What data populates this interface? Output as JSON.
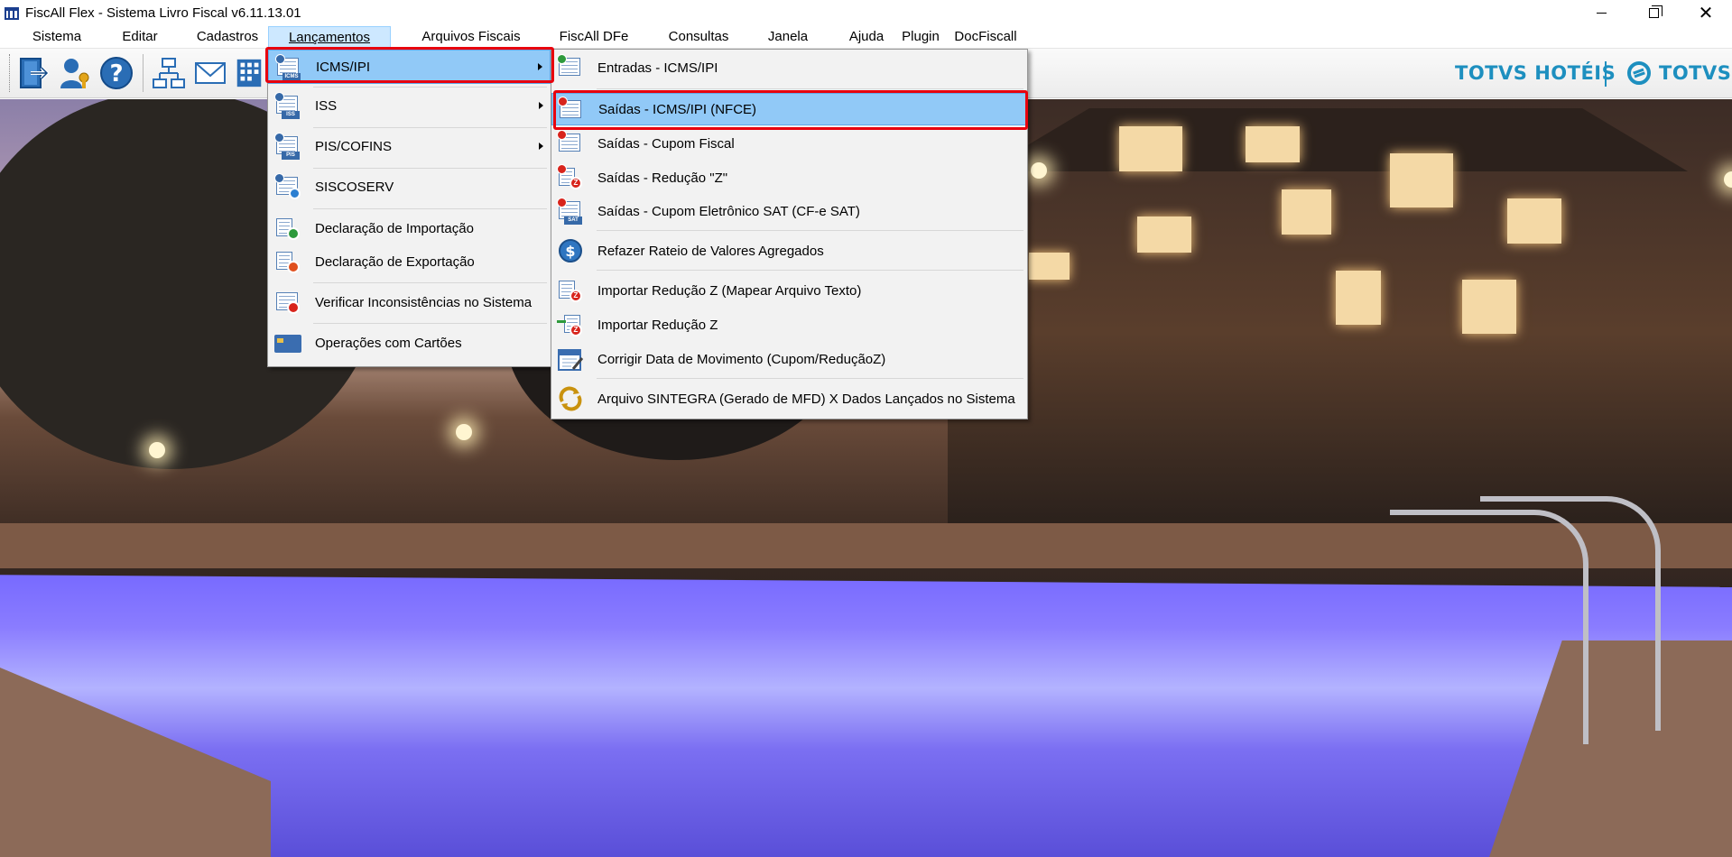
{
  "window": {
    "title": "FiscAll Flex - Sistema Livro Fiscal v6.11.13.01",
    "controls": {
      "minimize": "minimize-icon",
      "maximize": "restore-icon",
      "close": "close-icon"
    }
  },
  "menubar": {
    "items": [
      {
        "label": "Sistema"
      },
      {
        "label": "Editar"
      },
      {
        "label": "Cadastros"
      },
      {
        "label": "Lançamentos",
        "active": true
      },
      {
        "label": "Arquivos Fiscais"
      },
      {
        "label": "FiscAll DFe"
      },
      {
        "label": "Consultas"
      },
      {
        "label": "Janela"
      },
      {
        "label": "Ajuda"
      },
      {
        "label": "Plugin"
      },
      {
        "label": "DocFiscall"
      }
    ]
  },
  "toolbar": {
    "buttons": [
      "exit-icon",
      "user-key-icon",
      "help-icon",
      "org-chart-icon",
      "mail-icon",
      "calculator-icon"
    ]
  },
  "brand": {
    "product": "TOTVS HOTÉIS",
    "company": "TOTVS"
  },
  "lancamentos_menu": {
    "items": [
      {
        "label": "ICMS/IPI",
        "icon": "icms-form-icon",
        "has_submenu": true,
        "highlighted": true
      },
      {
        "label": "ISS",
        "icon": "iss-form-icon",
        "has_submenu": true
      },
      {
        "label": "PIS/COFINS",
        "icon": "pis-form-icon",
        "has_submenu": true
      },
      {
        "label": "SISCOSERV",
        "icon": "siscoserv-icon"
      },
      {
        "label": "Declaração de Importação",
        "icon": "import-declaration-icon"
      },
      {
        "label": "Declaração de Exportação",
        "icon": "export-declaration-icon"
      },
      {
        "label": "Verificar Inconsistências no Sistema",
        "icon": "warning-form-icon"
      },
      {
        "label": "Operações com Cartões",
        "icon": "card-icon"
      }
    ]
  },
  "icms_submenu": {
    "items": [
      {
        "label": "Entradas - ICMS/IPI",
        "icon": "spreadsheet-plus-icon"
      },
      {
        "label": "Saídas - ICMS/IPI (NFCE)",
        "icon": "spreadsheet-minus-icon",
        "highlighted": true
      },
      {
        "label": "Saídas - Cupom Fiscal",
        "icon": "receipt-icon"
      },
      {
        "label": "Saídas - Redução \"Z\"",
        "icon": "reduction-z-icon"
      },
      {
        "label": "Saídas - Cupom Eletrônico SAT (CF-e SAT)",
        "icon": "sat-icon"
      },
      {
        "label": "Refazer Rateio de Valores Agregados",
        "icon": "dollar-refresh-icon"
      },
      {
        "label": "Importar Redução Z (Mapear Arquivo Texto)",
        "icon": "import-text-z-icon"
      },
      {
        "label": "Importar Redução Z",
        "icon": "import-z-icon"
      },
      {
        "label": "Corrigir Data de Movimento (Cupom/ReduçãoZ)",
        "icon": "calendar-edit-icon"
      },
      {
        "label": "Arquivo SINTEGRA (Gerado de MFD) X Dados Lançados no Sistema",
        "icon": "sync-arrows-icon"
      }
    ]
  },
  "colors": {
    "accent": "#91c9f7",
    "annotation": "#e8000d",
    "brand": "#1d8fbf"
  }
}
